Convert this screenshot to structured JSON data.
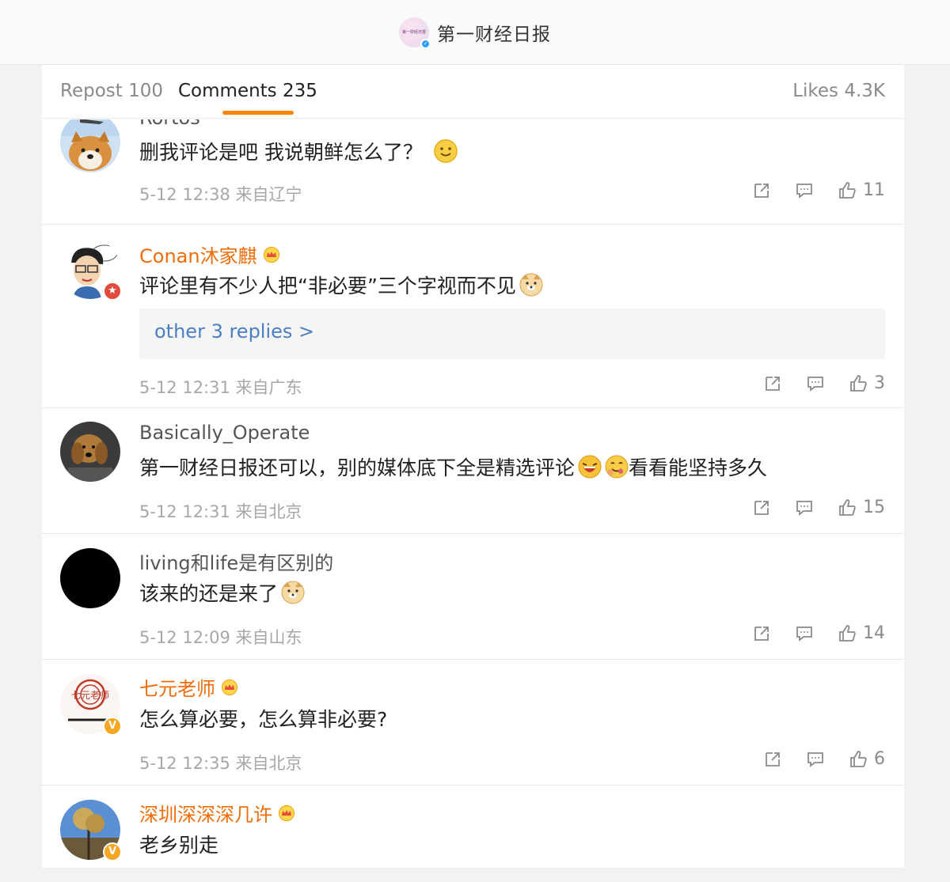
{
  "header": {
    "title": "第一财经日报",
    "logo_text": "第一财经日报",
    "logo_icon": "account-logo-icon"
  },
  "tabs": {
    "repost": "Repost 100",
    "comments": "Comments 235",
    "likes": "Likes 4.3K",
    "active_color": "#ff8200"
  },
  "colors": {
    "vip_name": "#f06d0c",
    "link": "#4a7fc1",
    "meta": "#a7a7a7"
  },
  "comments": [
    {
      "user": "Rortos",
      "text": "删我评论是吧 我说朝鲜怎么了？",
      "emoji": "smile-emoji",
      "time": "5-12 12:38",
      "location": "来自辽宁",
      "likes": "11",
      "vip": false
    },
    {
      "user": "Conan沐家麒",
      "text": "评论里有不少人把“非必要”三个字视而不见",
      "emoji": "doge-emoji",
      "replies": "other 3 replies >",
      "time": "5-12 12:31",
      "location": "来自广东",
      "likes": "3",
      "vip": true
    },
    {
      "user": "Basically_Operate",
      "text_before": "第一财经日报还可以，别的媒体底下全是精选评论",
      "text_after": "看看能坚持多久",
      "emoji": "laugh-emoji",
      "emoji2": "yummy-emoji",
      "time": "5-12 12:31",
      "location": "来自北京",
      "likes": "15",
      "vip": false
    },
    {
      "user": "living和life是有区别的",
      "text": "该来的还是来了",
      "emoji": "doge-emoji",
      "time": "5-12 12:09",
      "location": "来自山东",
      "likes": "14",
      "vip": false
    },
    {
      "user": "七元老师",
      "text": "怎么算必要，怎么算非必要?",
      "time": "5-12 12:35",
      "location": "来自北京",
      "likes": "6",
      "vip": true,
      "avatar_text": "七元老师"
    },
    {
      "user": "深圳深深深几许",
      "text": "老乡别走",
      "vip": true
    }
  ]
}
